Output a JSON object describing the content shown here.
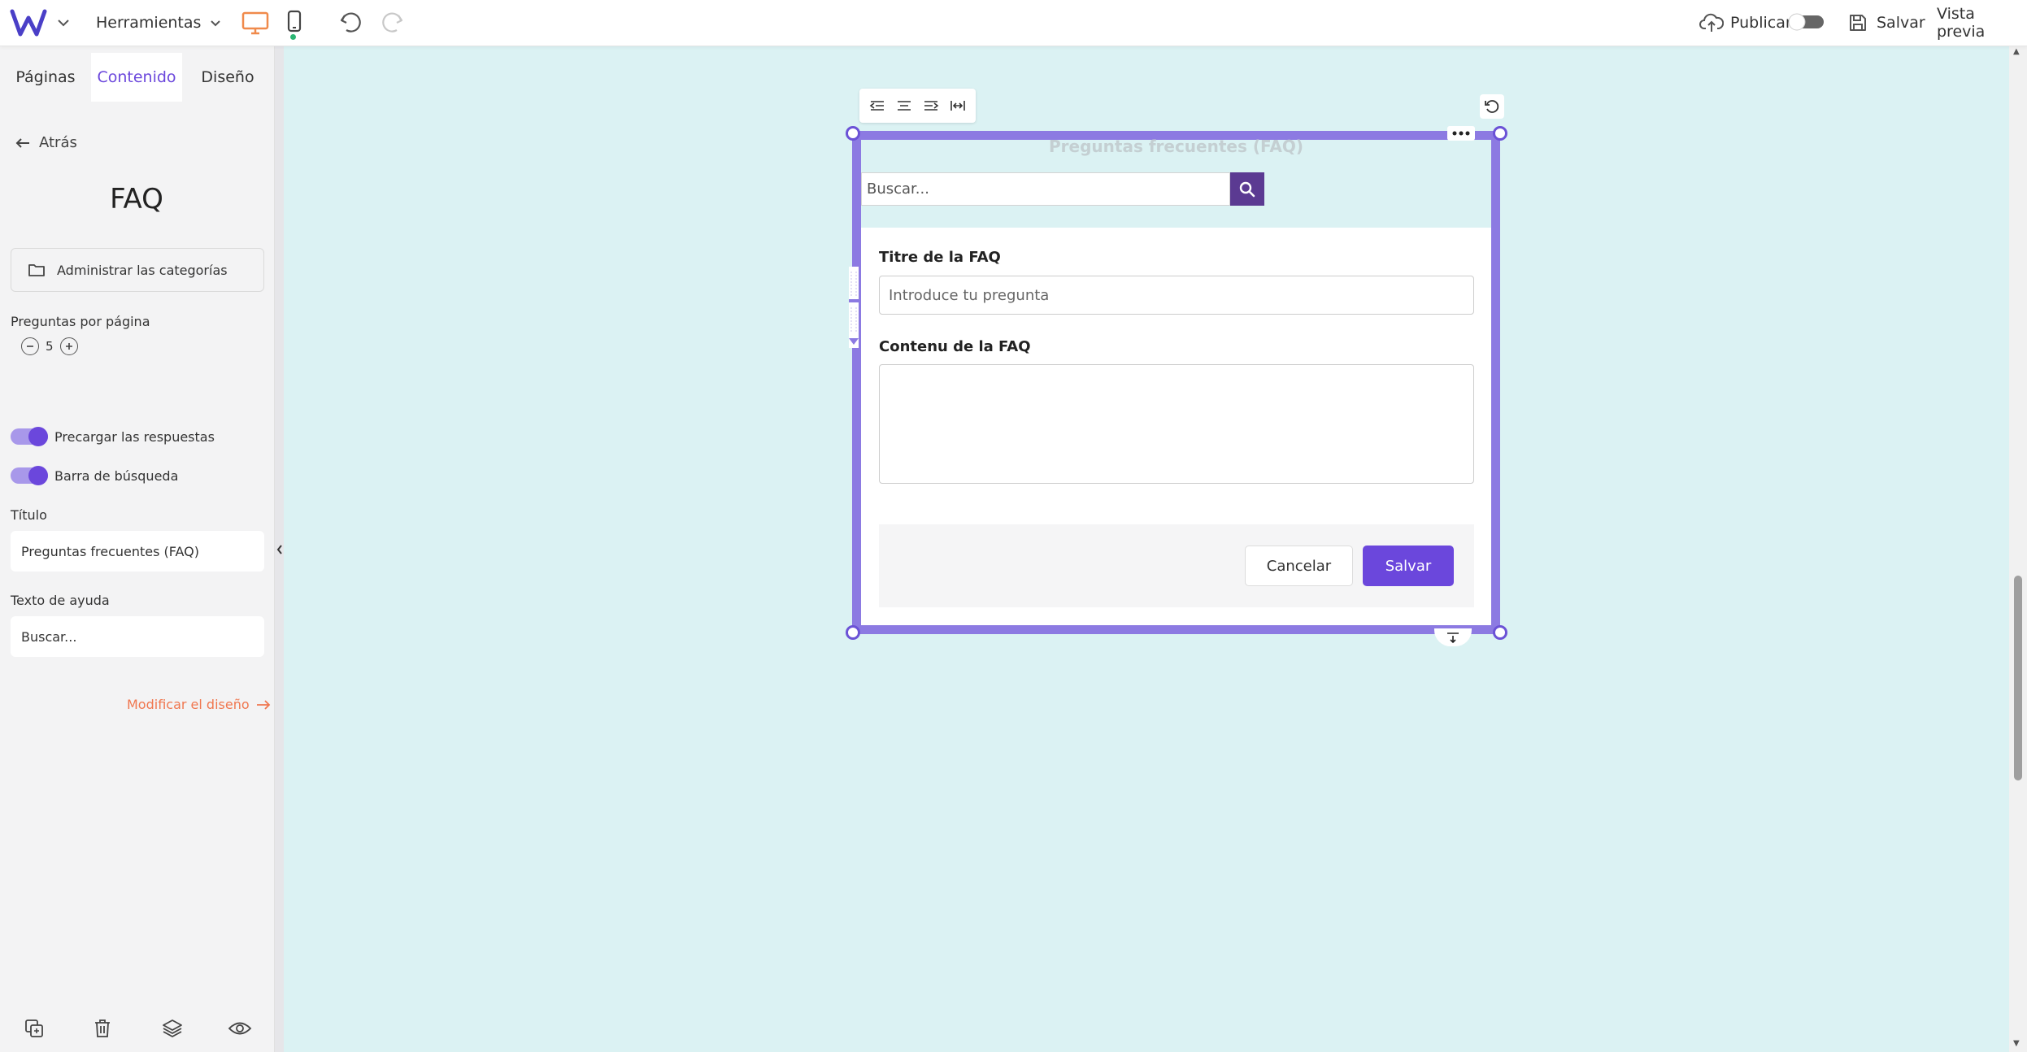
{
  "topbar": {
    "tools_label": "Herramientas",
    "publish_label": "Publicar",
    "save_label": "Salvar",
    "preview_label": "Vista previa",
    "publish_toggle_on": false
  },
  "sidebar": {
    "tabs": [
      {
        "label": "Páginas",
        "active": false
      },
      {
        "label": "Contenido",
        "active": true
      },
      {
        "label": "Diseño",
        "active": false
      }
    ],
    "back_label": "Atrás",
    "title": "FAQ",
    "manage_categories_label": "Administrar las categorías",
    "questions_per_page_label": "Preguntas por página",
    "questions_per_page_value": "5",
    "preload_answers_label": "Precargar las respuestas",
    "preload_answers_on": true,
    "search_bar_label": "Barra de búsqueda",
    "search_bar_on": true,
    "title_label": "Título",
    "title_value": "Preguntas frecuentes (FAQ)",
    "help_text_label": "Texto de ayuda",
    "help_text_value": "Buscar...",
    "modify_design_label": "Modificar el diseño"
  },
  "canvas": {
    "faq_title": "Preguntas frecuentes (FAQ)",
    "search_placeholder": "Buscar...",
    "form": {
      "question_label": "Titre de la FAQ",
      "question_placeholder": "Introduce tu pregunta",
      "content_label": "Contenu de la FAQ",
      "cancel_label": "Cancelar",
      "save_label": "Salvar"
    }
  },
  "colors": {
    "accent": "#6b47dc",
    "frame": "#8c7ae2",
    "canvas_bg": "#dbf2f3",
    "link_orange": "#f0774f",
    "search_button": "#5b3a92"
  }
}
